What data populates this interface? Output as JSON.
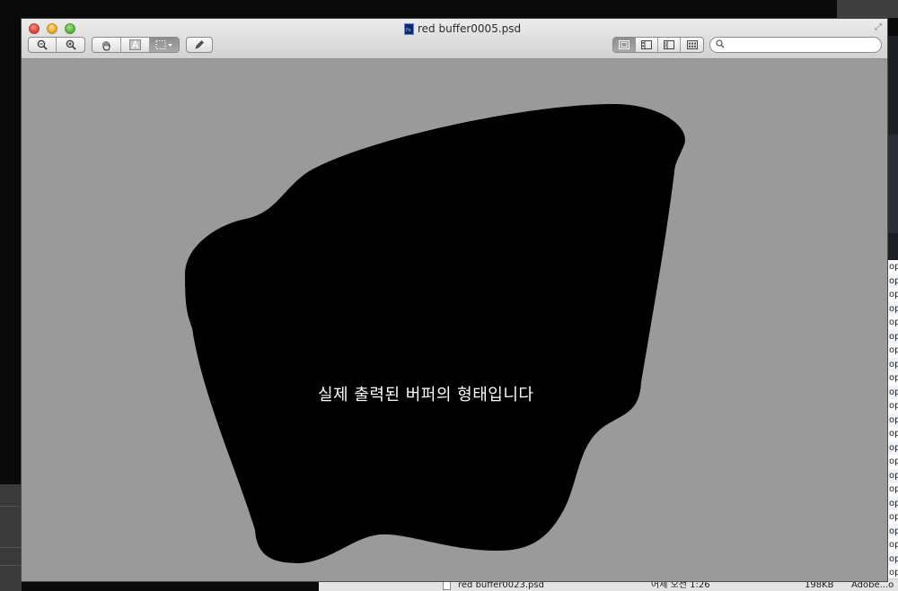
{
  "window": {
    "title": "red buffer0005.psd"
  },
  "toolbar": {
    "zoom_out_icon": "zoom-out-icon",
    "zoom_in_icon": "zoom-in-icon",
    "hand_icon": "hand-icon",
    "text_select_icon": "text-select-icon",
    "rect_select_icon": "rect-select-icon",
    "annotate_icon": "pencil-icon",
    "view_modes": [
      "content-only",
      "thumbnails",
      "table-of-contents",
      "contact-sheet"
    ],
    "search_placeholder": ""
  },
  "image": {
    "caption": "실제 출력된 버퍼의 형태입니다",
    "background_color": "#9a9a9a",
    "shape_color": "#000000"
  },
  "finder_background": {
    "list_fragment": [
      "op",
      "op",
      "op",
      "op",
      "op",
      "op",
      "op",
      "op",
      "op",
      "op",
      "op",
      "op",
      "op",
      "op",
      "op",
      "op",
      "op",
      "op",
      "op",
      "op",
      "op",
      "op",
      "op"
    ],
    "bottom_row": {
      "name": "red buffer0023.psd",
      "date": "어제 오전 1:26",
      "size": "198KB",
      "kind": "Adobe...o"
    }
  }
}
